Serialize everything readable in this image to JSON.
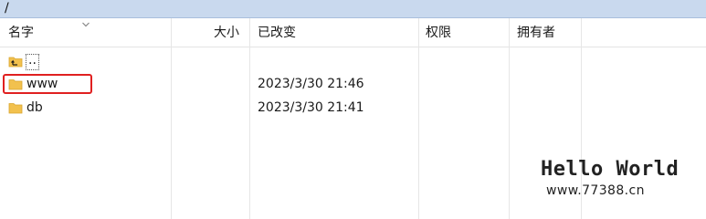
{
  "path": "/",
  "columns": {
    "name": "名字",
    "size": "大小",
    "modified": "已改变",
    "permissions": "权限",
    "owner": "拥有者"
  },
  "rows": [
    {
      "name": "..",
      "size": "",
      "modified": "",
      "permissions": "",
      "owner": "",
      "icon": "parent-folder-icon"
    },
    {
      "name": "www",
      "size": "",
      "modified": "2023/3/30 21:46",
      "permissions": "",
      "owner": "",
      "icon": "folder-icon",
      "highlighted": true
    },
    {
      "name": "db",
      "size": "",
      "modified": "2023/3/30 21:41",
      "permissions": "",
      "owner": "",
      "icon": "folder-icon"
    }
  ],
  "watermark": {
    "title": "Hello World",
    "url": "www.77388.cn"
  },
  "colors": {
    "pathbar": "#c9d9ee",
    "folder": "#f2c14e",
    "highlight": "#e02020"
  }
}
